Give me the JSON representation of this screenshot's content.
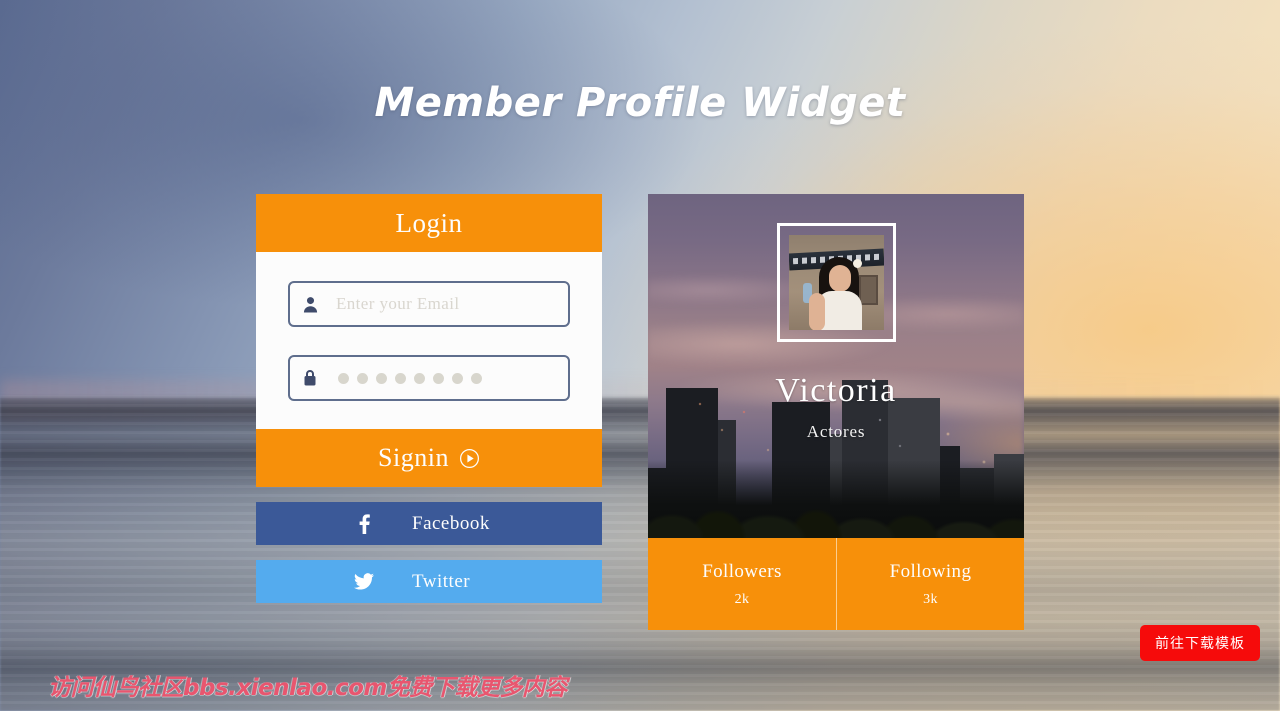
{
  "page": {
    "title": "Member Profile Widget"
  },
  "login": {
    "header": "Login",
    "email": {
      "icon": "user-icon",
      "value": "",
      "placeholder": "Enter your Email"
    },
    "password": {
      "icon": "lock-icon",
      "masked_value": "••••••••",
      "dot_count": 8
    },
    "signin_label": "Signin",
    "signin_icon": "play-circle-icon",
    "social": [
      {
        "name": "facebook",
        "label": "Facebook",
        "icon": "facebook-icon",
        "color": "#3b5998"
      },
      {
        "name": "twitter",
        "label": "Twitter",
        "icon": "twitter-icon",
        "color": "#54abee"
      }
    ]
  },
  "profile": {
    "avatar_alt": "Victoria portrait",
    "name": "Victoria",
    "role": "Actores",
    "stats": [
      {
        "label": "Followers",
        "value": "2k"
      },
      {
        "label": "Following",
        "value": "3k"
      }
    ]
  },
  "overlay": {
    "watermark": "访问仙鸟社区bbs.xienlao.com免费下载更多内容",
    "download_button": "前往下载模板"
  },
  "colors": {
    "accent_orange": "#f7900a",
    "facebook_blue": "#3b5998",
    "twitter_blue": "#54abee",
    "input_border": "#5f6e8d",
    "panel_white": "#fcfcfc",
    "watermark_pink": "#e8566f",
    "download_red": "#f60b0b"
  }
}
